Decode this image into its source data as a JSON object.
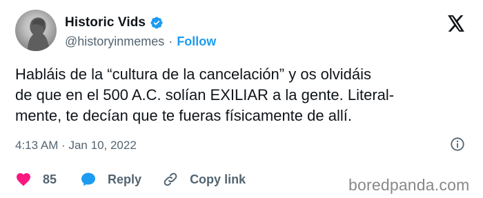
{
  "author": {
    "display_name": "Historic Vids",
    "handle": "@historyinmemes",
    "separator": "·",
    "follow_label": "Follow"
  },
  "tweet": {
    "lines": [
      "Habláis de la “cultura de la cancelación” y os olvidáis",
      "de que en el 500 A.C. solían EXILIAR a la gente. Literal-",
      "mente, te decían que te fueras físicamente de allí."
    ],
    "timestamp": "4:13 AM · Jan 10, 2022"
  },
  "actions": {
    "like_count": "85",
    "reply_label": "Reply",
    "copy_link_label": "Copy link"
  },
  "icons": {
    "verified": "verified-badge-icon",
    "platform": "x-logo-icon",
    "info": "info-icon",
    "like": "heart-icon",
    "reply": "reply-bubble-icon",
    "copy": "link-icon"
  },
  "colors": {
    "accent": "#1d9bf0",
    "like": "#f91880",
    "secondary_text": "#536471",
    "primary_text": "#0f1419"
  },
  "watermark": "boredpanda.com"
}
